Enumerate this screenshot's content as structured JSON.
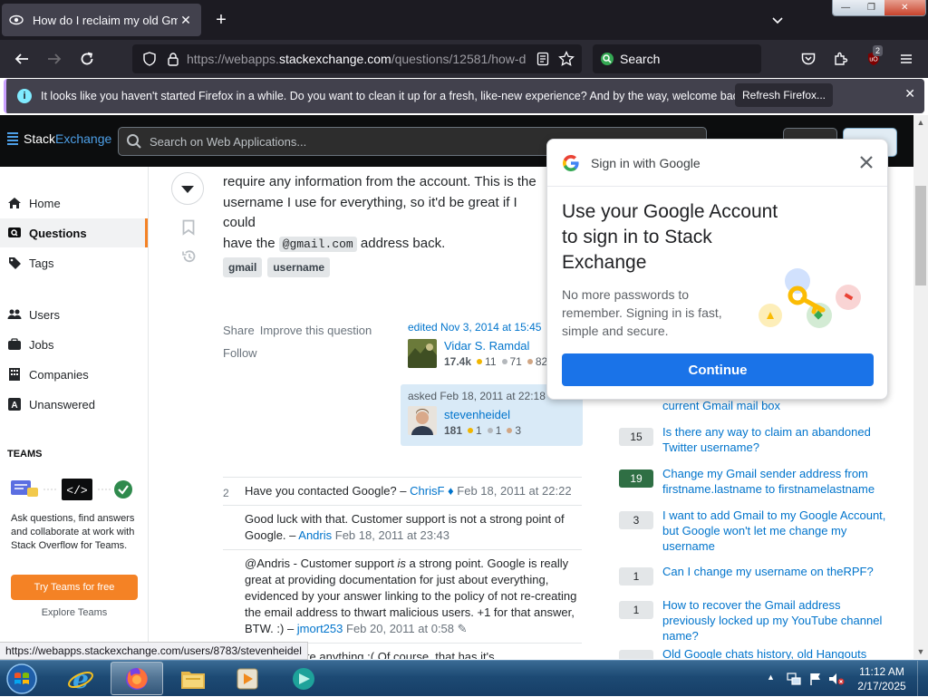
{
  "browser": {
    "tab_title": "How do I reclaim my old Gmail",
    "url_host": "https://webapps.",
    "url_domain": "stackexchange.com",
    "url_path": "/questions/12581/how-d",
    "search_placeholder": "Search",
    "extension_badge": "2",
    "window_controls": [
      "—",
      "❐",
      "✕"
    ]
  },
  "infobar": {
    "message": "It looks like you haven't started Firefox in a while. Do you want to clean it up for a fresh, like-new experience? And by the way, welcome back!",
    "button": "Refresh Firefox..."
  },
  "site": {
    "logo_part1": "Stack",
    "logo_part2": "Exchange",
    "search_placeholder": "Search on Web Applications..."
  },
  "leftnav": {
    "items": [
      {
        "label": "Home",
        "icon": "home-icon"
      },
      {
        "label": "Questions",
        "icon": "questions-icon",
        "active": true
      },
      {
        "label": "Tags",
        "icon": "tag-icon"
      },
      {
        "label": "Users",
        "icon": "users-icon"
      },
      {
        "label": "Jobs",
        "icon": "briefcase-icon"
      },
      {
        "label": "Companies",
        "icon": "building-icon"
      },
      {
        "label": "Unanswered",
        "icon": "unanswered-icon"
      }
    ],
    "teams_heading": "TEAMS",
    "teams_text": "Ask questions, find answers and collaborate at work with Stack Overflow for Teams.",
    "teams_button": "Try Teams for free",
    "teams_link": "Explore Teams"
  },
  "question": {
    "body_line1": "require any information from the account. This is the",
    "body_line2": "username I use for everything, so it'd be great if I could",
    "body_line3_pre": "have the ",
    "body_code": "@gmail.com",
    "body_line3_post": " address back.",
    "tags": [
      "gmail",
      "username"
    ],
    "share": "Share",
    "improve": "Improve this question",
    "follow": "Follow",
    "edited_label": "edited Nov 3, 2014 at 15:45",
    "editor": {
      "name": "Vidar S. Ramdal",
      "rep": "17.4k",
      "gold": "11",
      "silver": "71",
      "bronze": "82"
    },
    "asked_label": "asked Feb 18, 2011 at 22:18",
    "asker": {
      "name": "stevenheidel",
      "rep": "181",
      "gold": "1",
      "silver": "1",
      "bronze": "3"
    }
  },
  "comments": [
    {
      "score": "2",
      "text": "Have you contacted Google? – ",
      "user": "ChrisF",
      "mod": "♦",
      "time": "Feb 18, 2011 at 22:22"
    },
    {
      "score": "",
      "text": "Good luck with that. Customer support is not a strong point of Google. – ",
      "user": "Andris",
      "time": "Feb 18, 2011 at 23:43"
    },
    {
      "score": "",
      "text_pre": "@Andris - Customer support ",
      "text_em": "is",
      "text": " a strong point. Google is really great at providing documentation for just about everything, evidenced by your answer linking to the policy of not re-creating the email address to thwart malicious users. +1 for that answer, BTW. :) – ",
      "user": "jmort253",
      "time": "Feb 20, 2011 at 0:58",
      "edit": "✎"
    },
    {
      "score": "",
      "text": "I never delete anything :( Of course, that has it's",
      "user": "",
      "time": ""
    }
  ],
  "related": [
    {
      "count": "",
      "accepted": true,
      "title": "current Gmail mail box"
    },
    {
      "count": "15",
      "accepted": false,
      "title": "Is there any way to claim an abandoned Twitter username?"
    },
    {
      "count": "19",
      "accepted": true,
      "title": "Change my Gmail sender address from firstname.lastname to firstnamelastname"
    },
    {
      "count": "3",
      "accepted": false,
      "title": "I want to add Gmail to my Google Account, but Google won't let me change my username"
    },
    {
      "count": "1",
      "accepted": false,
      "title": "Can I change my username on theRPF?"
    },
    {
      "count": "1",
      "accepted": false,
      "title": "How to recover the Gmail address previously locked up my YouTube channel name?"
    },
    {
      "count": "",
      "accepted": false,
      "title": "Old Google chats history, old Hangouts"
    }
  ],
  "google_signin": {
    "header": "Sign in with Google",
    "headline": "Use your Google Account to sign in to Stack Exchange",
    "subtext": "No more passwords to remember. Signing in is fast, simple and secure.",
    "button": "Continue"
  },
  "status_url": "https://webapps.stackexchange.com/users/8783/stevenheidel",
  "taskbar": {
    "time": "11:12 AM",
    "date": "2/17/2025"
  },
  "colors": {
    "accent_orange": "#f48225",
    "link_blue": "#0074cc",
    "google_blue": "#1a73e8",
    "accepted_green": "#2f6f44"
  }
}
